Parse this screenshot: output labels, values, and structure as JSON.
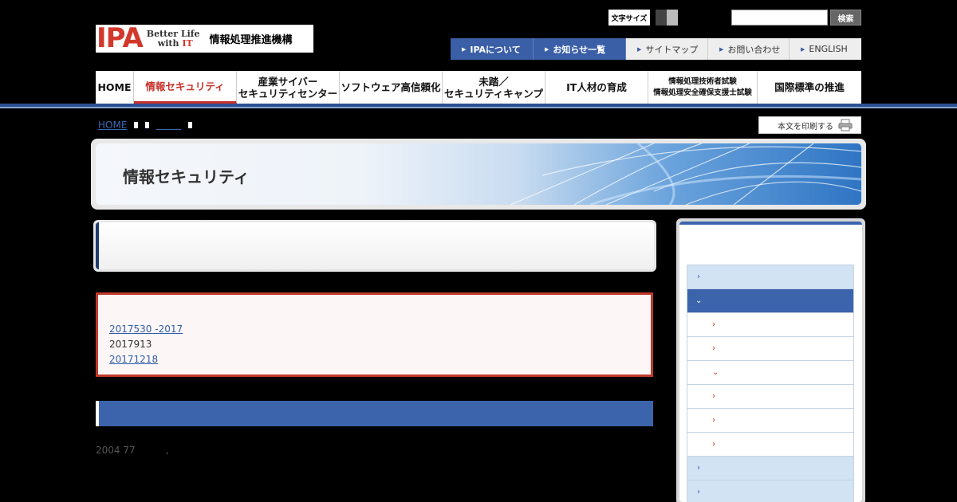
{
  "header": {
    "logo": {
      "mark": "IPA",
      "tagline_1": "Better Life",
      "tagline_2_pre": "with ",
      "tagline_2_it": "IT",
      "org_name": "情報処理推進機構"
    },
    "text_size_label": "文字サイズ",
    "search": {
      "button_label": "検索",
      "value": ""
    },
    "util_nav": [
      {
        "label": "IPAについて",
        "style": "dark"
      },
      {
        "label": "お知らせ一覧",
        "style": "dark"
      },
      {
        "label": "サイトマップ",
        "style": "light"
      },
      {
        "label": "お問い合わせ",
        "style": "light"
      },
      {
        "label": "ENGLISH",
        "style": "light"
      }
    ]
  },
  "global_nav": {
    "home": "HOME",
    "security": "情報セキュリティ",
    "ics_1": "産業サイバー",
    "ics_2": "セキュリティセンター",
    "software": "ソフトウェア高信頼化",
    "camp_1": "未踏／",
    "camp_2": "セキュリティキャンプ",
    "hr": "IT人材の育成",
    "exam_1": "情報処理技術者試験",
    "exam_2": "情報処理安全確保支援士試験",
    "standards": "国際標準の推進"
  },
  "breadcrumb": {
    "home": "HOME"
  },
  "print_label": "本文を印刷する",
  "banner_title": "情報セキュリティ",
  "notice": {
    "line1": "2017530 -2017",
    "line2": "2017913",
    "line3": "20171218"
  },
  "body_text": "2004 77          ,",
  "colors": {
    "accent_blue": "#3b64ac",
    "accent_red": "#c8302a",
    "link": "#2f5fa8"
  }
}
